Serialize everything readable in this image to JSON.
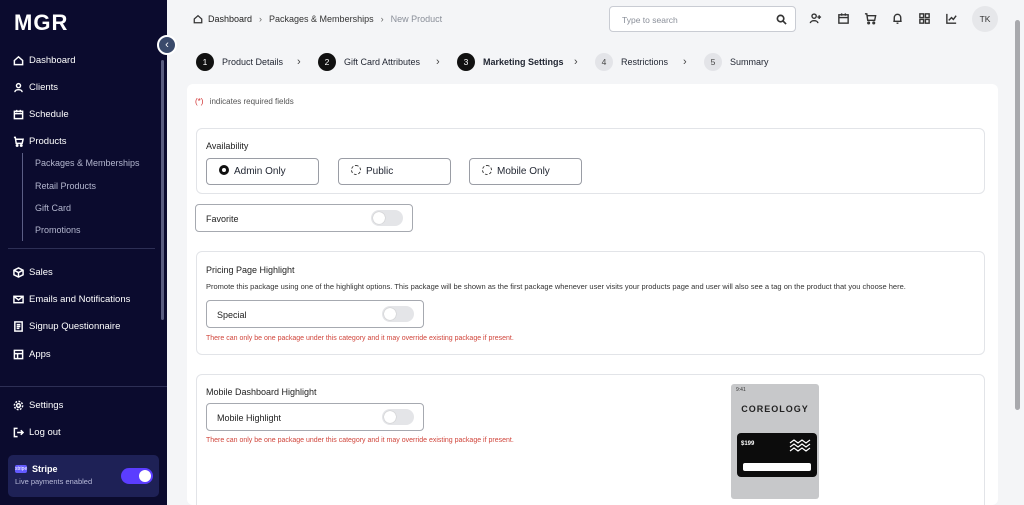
{
  "app": {
    "logo": "MGR"
  },
  "sidebar": {
    "items": [
      {
        "label": "Dashboard",
        "icon": "home-icon"
      },
      {
        "label": "Clients",
        "icon": "user-icon"
      },
      {
        "label": "Schedule",
        "icon": "calendar-icon"
      },
      {
        "label": "Products",
        "icon": "cart-icon"
      },
      {
        "label": "Sales",
        "icon": "box-icon"
      },
      {
        "label": "Emails and Notifications",
        "icon": "mail-icon"
      },
      {
        "label": "Signup Questionnaire",
        "icon": "form-icon"
      },
      {
        "label": "Apps",
        "icon": "apps-icon"
      }
    ],
    "sub_items": [
      "Packages & Memberships",
      "Retail Products",
      "Gift Card",
      "Promotions"
    ],
    "bottom": [
      {
        "label": "Settings",
        "icon": "gear-icon"
      },
      {
        "label": "Log out",
        "icon": "logout-icon"
      }
    ],
    "stripe": {
      "logo": "stripe",
      "title": "Stripe",
      "subtitle": "Live payments enabled",
      "enabled": true
    }
  },
  "header": {
    "breadcrumb": [
      "Dashboard",
      "Packages & Memberships",
      "New Product"
    ],
    "search_placeholder": "Type to search",
    "avatar": "TK"
  },
  "stepper": {
    "steps": [
      {
        "num": "1",
        "label": "Product Details",
        "state": "done"
      },
      {
        "num": "2",
        "label": "Gift Card Attributes",
        "state": "done"
      },
      {
        "num": "3",
        "label": "Marketing Settings",
        "state": "active"
      },
      {
        "num": "4",
        "label": "Restrictions",
        "state": "pending"
      },
      {
        "num": "5",
        "label": "Summary",
        "state": "pending"
      }
    ]
  },
  "form": {
    "required_note": "indicates required fields",
    "required_marker": "(*)",
    "availability": {
      "title": "Availability",
      "options": [
        "Admin Only",
        "Public",
        "Mobile Only"
      ],
      "selected": "Admin Only"
    },
    "favorite": {
      "label": "Favorite",
      "enabled": false
    },
    "pricing_highlight": {
      "title": "Pricing Page Highlight",
      "description": "Promote this package using one of the highlight options. This package will be shown as the first package whenever user visits your products page and user will also see a tag on the product that you choose here.",
      "toggle_label": "Special",
      "enabled": false,
      "warning": "There can only be one package under this category and it may override existing package if present."
    },
    "mobile_highlight": {
      "title": "Mobile Dashboard Highlight",
      "toggle_label": "Mobile Highlight",
      "enabled": false,
      "warning": "There can only be one package under this category and it may override existing package if present.",
      "preview_brand": "COREOLOGY",
      "preview_price": "$199",
      "preview_time": "9:41"
    }
  },
  "colors": {
    "sidebar_bg": "#0b0b2e",
    "accent": "#5b3dff",
    "warning": "#d0453b"
  }
}
